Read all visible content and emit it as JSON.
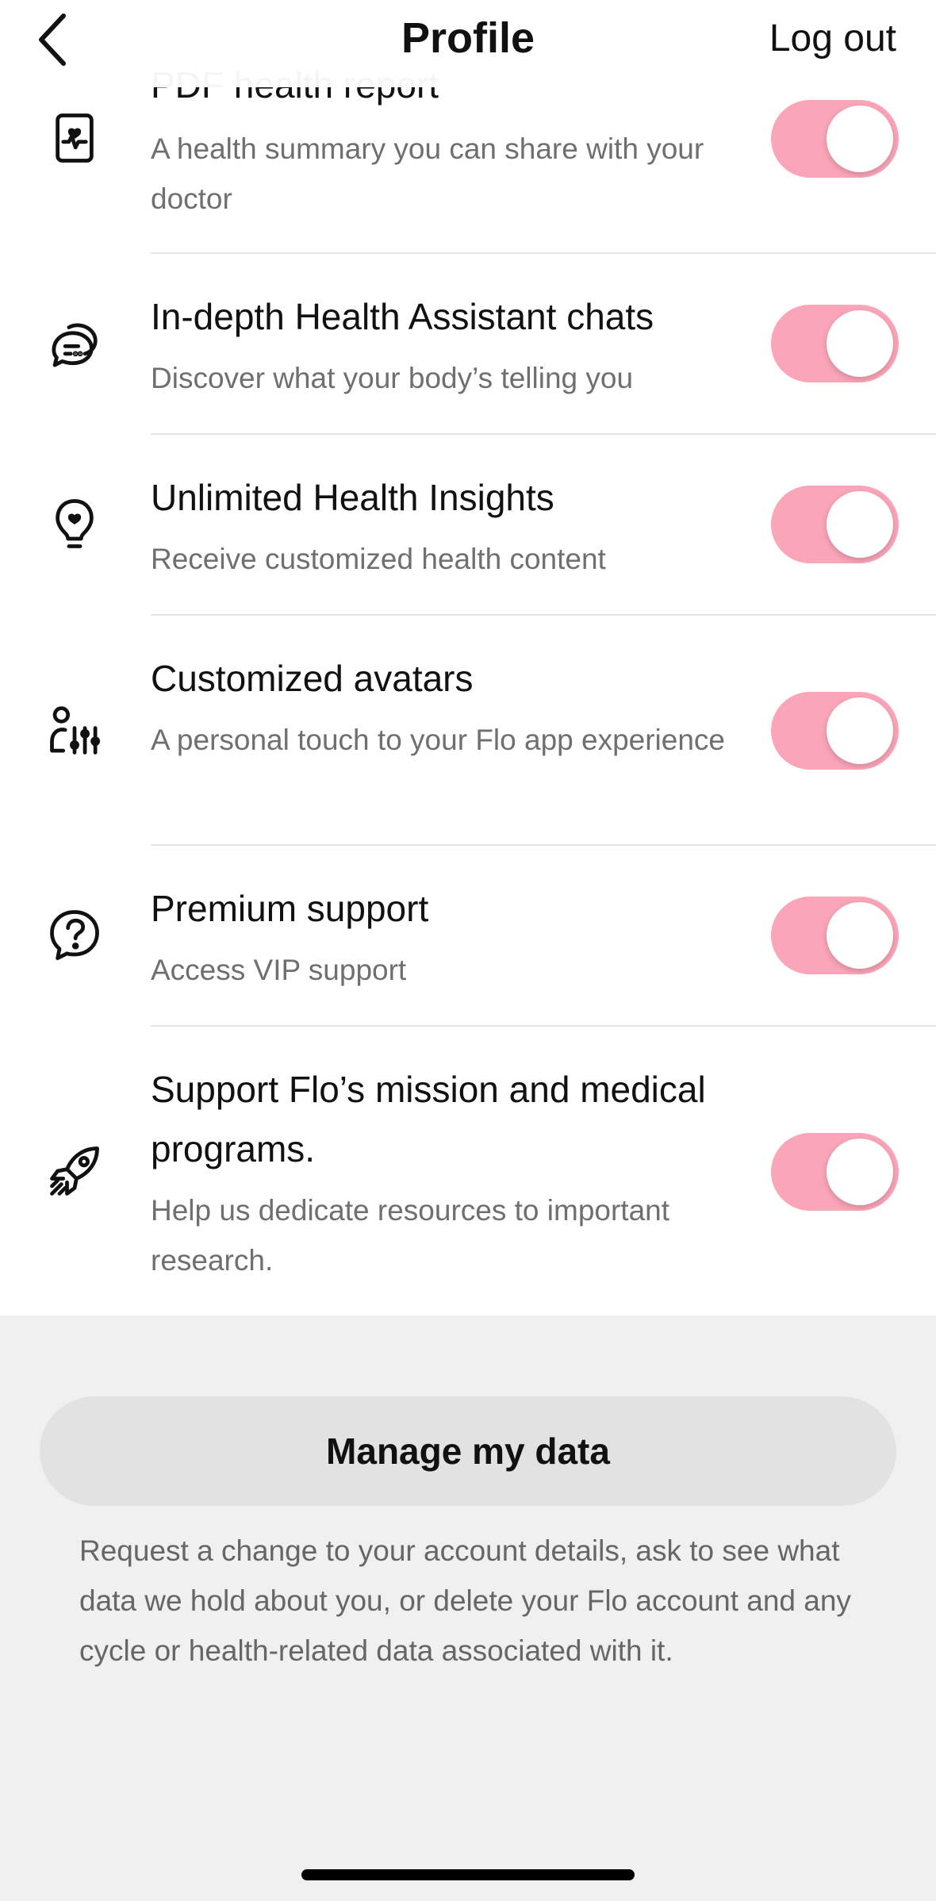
{
  "header": {
    "title": "Profile",
    "logout_label": "Log out"
  },
  "features": [
    {
      "title": "PDF health report",
      "description": "A health summary you can share with your doctor",
      "icon": "health-report-icon",
      "enabled": true
    },
    {
      "title": "In-depth Health Assistant chats",
      "description": "Discover what your body’s telling you",
      "icon": "chat-bubbles-icon",
      "enabled": true
    },
    {
      "title": "Unlimited Health Insights",
      "description": "Receive customized health content",
      "icon": "lightbulb-heart-icon",
      "enabled": true
    },
    {
      "title": "Customized avatars",
      "description": "A personal touch to your Flo app experience",
      "icon": "avatar-settings-icon",
      "enabled": true
    },
    {
      "title": "Premium support",
      "description": "Access VIP support",
      "icon": "question-bubble-icon",
      "enabled": true
    },
    {
      "title": "Support Flo’s mission and medical programs.",
      "description": "Help us dedicate resources to important research.",
      "icon": "rocket-icon",
      "enabled": true
    }
  ],
  "manage": {
    "button_label": "Manage my data",
    "note": "Request a change to your account details, ask to see what data we hold about you, or delete your Flo account and any cycle or health-related data associated with it."
  },
  "colors": {
    "toggle_on": "#fba5b8",
    "list_background": "#ffffff",
    "page_background": "#f0f0f0",
    "manage_button": "#e2e2e2"
  }
}
